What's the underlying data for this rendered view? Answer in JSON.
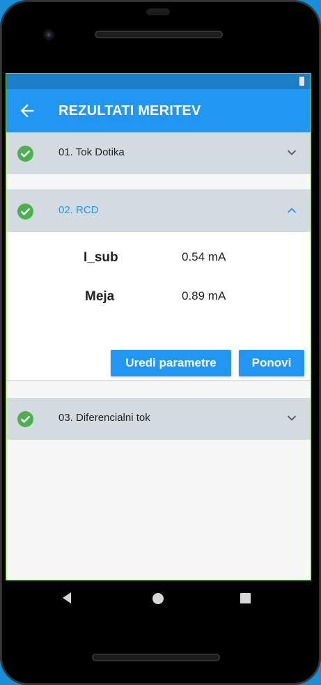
{
  "app_bar": {
    "title": "REZULTATI MERITEV"
  },
  "sections": [
    {
      "label": "01. Tok Dotika",
      "expanded": false,
      "status": "check-icon"
    },
    {
      "label": "02. RCD",
      "expanded": true,
      "status": "check-icon"
    },
    {
      "label": "03. Diferencialni tok",
      "expanded": false,
      "status": "check-icon"
    }
  ],
  "rcd": {
    "params": [
      {
        "name": "I_sub",
        "value": "0.54 mA"
      },
      {
        "name": "Meja",
        "value": "0.89 mA"
      }
    ],
    "edit_button": "Uredi parametre",
    "repeat_button": "Ponovi"
  },
  "colors": {
    "accent": "#2196f3",
    "status_bar": "#1b7fc8",
    "header_bg": "#d4dbe0",
    "check": "#4caf50"
  }
}
